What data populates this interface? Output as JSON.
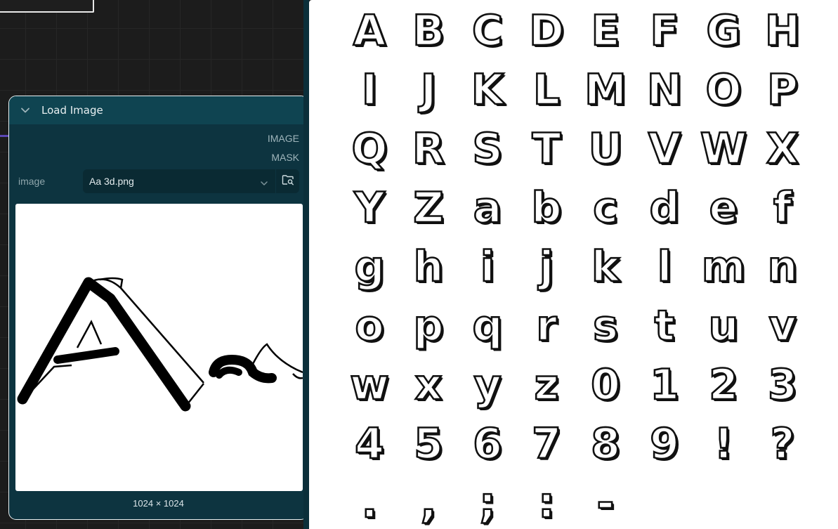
{
  "node": {
    "title": "Load Image",
    "outputs": [
      {
        "label": "IMAGE",
        "color": "#5b47b5"
      },
      {
        "label": "MASK",
        "color": "#c9c4e8"
      }
    ],
    "widget": {
      "label": "image",
      "value": "Aa 3d.png"
    },
    "dimensions": "1024 × 1024",
    "icons": {
      "collapse": "chevron-down-icon",
      "combo": "chevron-down-icon",
      "upload": "folder-search-icon"
    }
  },
  "colors": {
    "node_bg": "#0d3440",
    "header_bg": "#0f4451",
    "canvas_bg": "#1c1c1c"
  },
  "glyph_rows": [
    [
      "A",
      "B",
      "C",
      "D",
      "E",
      "F",
      "G",
      "H"
    ],
    [
      "I",
      "J",
      "K",
      "L",
      "M",
      "N",
      "O",
      "P"
    ],
    [
      "Q",
      "R",
      "S",
      "T",
      "U",
      "V",
      "W",
      "X"
    ],
    [
      "Y",
      "Z",
      "a",
      "b",
      "c",
      "d",
      "e",
      "f"
    ],
    [
      "g",
      "h",
      "i",
      "j",
      "k",
      "l",
      "m",
      "n"
    ],
    [
      "o",
      "p",
      "q",
      "r",
      "s",
      "t",
      "u",
      "v"
    ],
    [
      "w",
      "x",
      "y",
      "z",
      "0",
      "1",
      "2",
      "3"
    ],
    [
      "4",
      "5",
      "6",
      "7",
      "8",
      "9",
      "!",
      "?"
    ],
    [
      ".",
      ",",
      ";",
      ":",
      "-"
    ]
  ]
}
